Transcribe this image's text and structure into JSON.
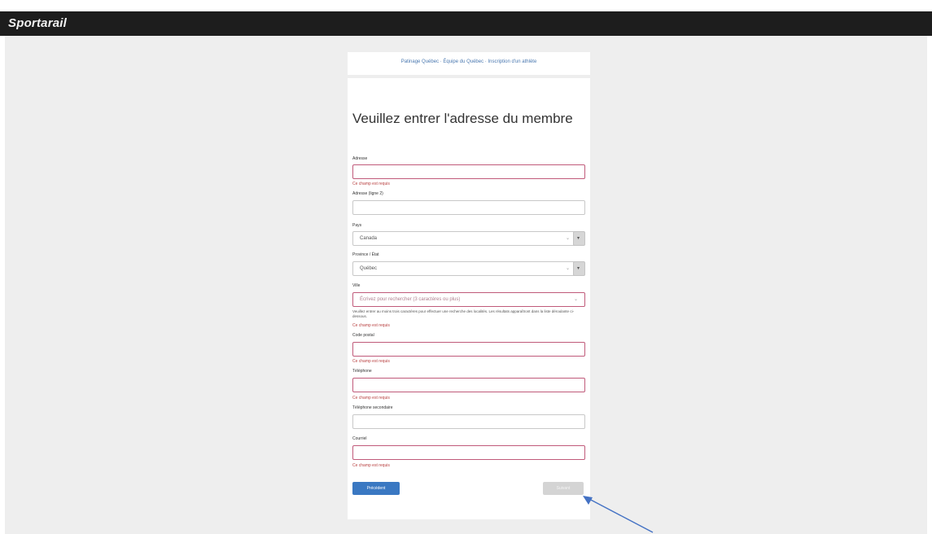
{
  "app": {
    "logo": "Sportarail"
  },
  "breadcrumb": "Patinage Québec · Équipe du Québec · Inscription d'un athlète",
  "form": {
    "title": "Veuillez entrer l'adresse du membre",
    "required_msg": "Ce champ est requis",
    "fields": {
      "address": {
        "label": "Adresse",
        "value": ""
      },
      "address2": {
        "label": "Adresse (ligne 2)",
        "value": ""
      },
      "country": {
        "label": "Pays",
        "value": "Canada"
      },
      "province": {
        "label": "Province / État",
        "value": "Québec"
      },
      "city": {
        "label": "Ville",
        "placeholder": "Écrivez pour rechercher (3 caractères ou plus)",
        "help": "Veuillez entrer au moins trois caractères pour effectuer une recherche des localités. Les résultats apparaîtront dans la liste déroulante ci-dessous."
      },
      "postal": {
        "label": "Code postal",
        "value": ""
      },
      "phone": {
        "label": "Téléphone",
        "value": ""
      },
      "phone2": {
        "label": "Téléphone secondaire",
        "value": ""
      },
      "email": {
        "label": "Courriel",
        "value": ""
      }
    },
    "buttons": {
      "previous": "Précédent",
      "next": "Suivant"
    }
  },
  "annotation": {
    "arrow_color": "#4472c4"
  }
}
